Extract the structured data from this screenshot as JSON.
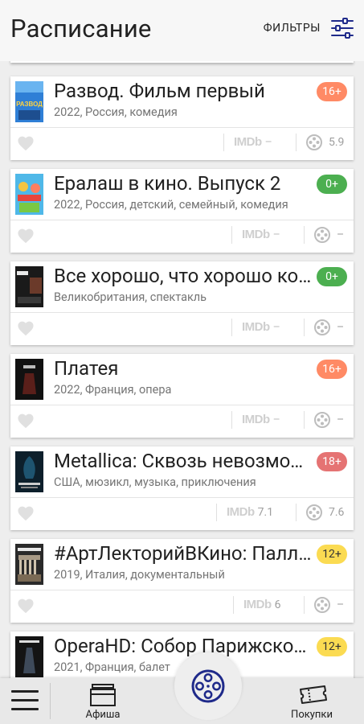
{
  "header": {
    "title": "Расписание",
    "filters_label": "ФИЛЬТРЫ"
  },
  "movies": [
    {
      "title": "Развод. Фильм первый",
      "meta": "2022, Россия, комедия",
      "age": "16+",
      "age_color": "#ff8a65",
      "imdb": "–",
      "rating": "5.9"
    },
    {
      "title": "Ералаш в кино. Выпуск 2",
      "meta": "2022, Россия, детский, семейный, комедия",
      "age": "0+",
      "age_color": "#4caf50",
      "imdb": "–",
      "rating": "–"
    },
    {
      "title": "Все хорошо, что хорошо кончается",
      "meta": "Великобритания, спектакль",
      "age": "0+",
      "age_color": "#4caf50",
      "imdb": "–",
      "rating": "–"
    },
    {
      "title": "Платея",
      "meta": "2022, Франция, опера",
      "age": "16+",
      "age_color": "#ff8a65",
      "imdb": "–",
      "rating": "–"
    },
    {
      "title": "Metallica: Сквозь невозможное",
      "meta": "США, мюзикл, музыка, приключения",
      "age": "18+",
      "age_color": "#e57373",
      "imdb": "7.1",
      "rating": "7.6"
    },
    {
      "title": "#АртЛекторийВКино: Палладио",
      "meta": "2019, Италия, документальный",
      "age": "12+",
      "age_color": "#fbdb52",
      "imdb": "6",
      "rating": "–"
    },
    {
      "title": "OperaHD: Собор Парижской Богоматери",
      "meta": "2021, Франция, балет",
      "age": "12+",
      "age_color": "#fbdb52",
      "imdb": "",
      "rating": ""
    }
  ],
  "imdb_label": "IMDb",
  "bottom_nav": {
    "afisha_label": "Афиша",
    "purchases_label": "Покупки"
  }
}
